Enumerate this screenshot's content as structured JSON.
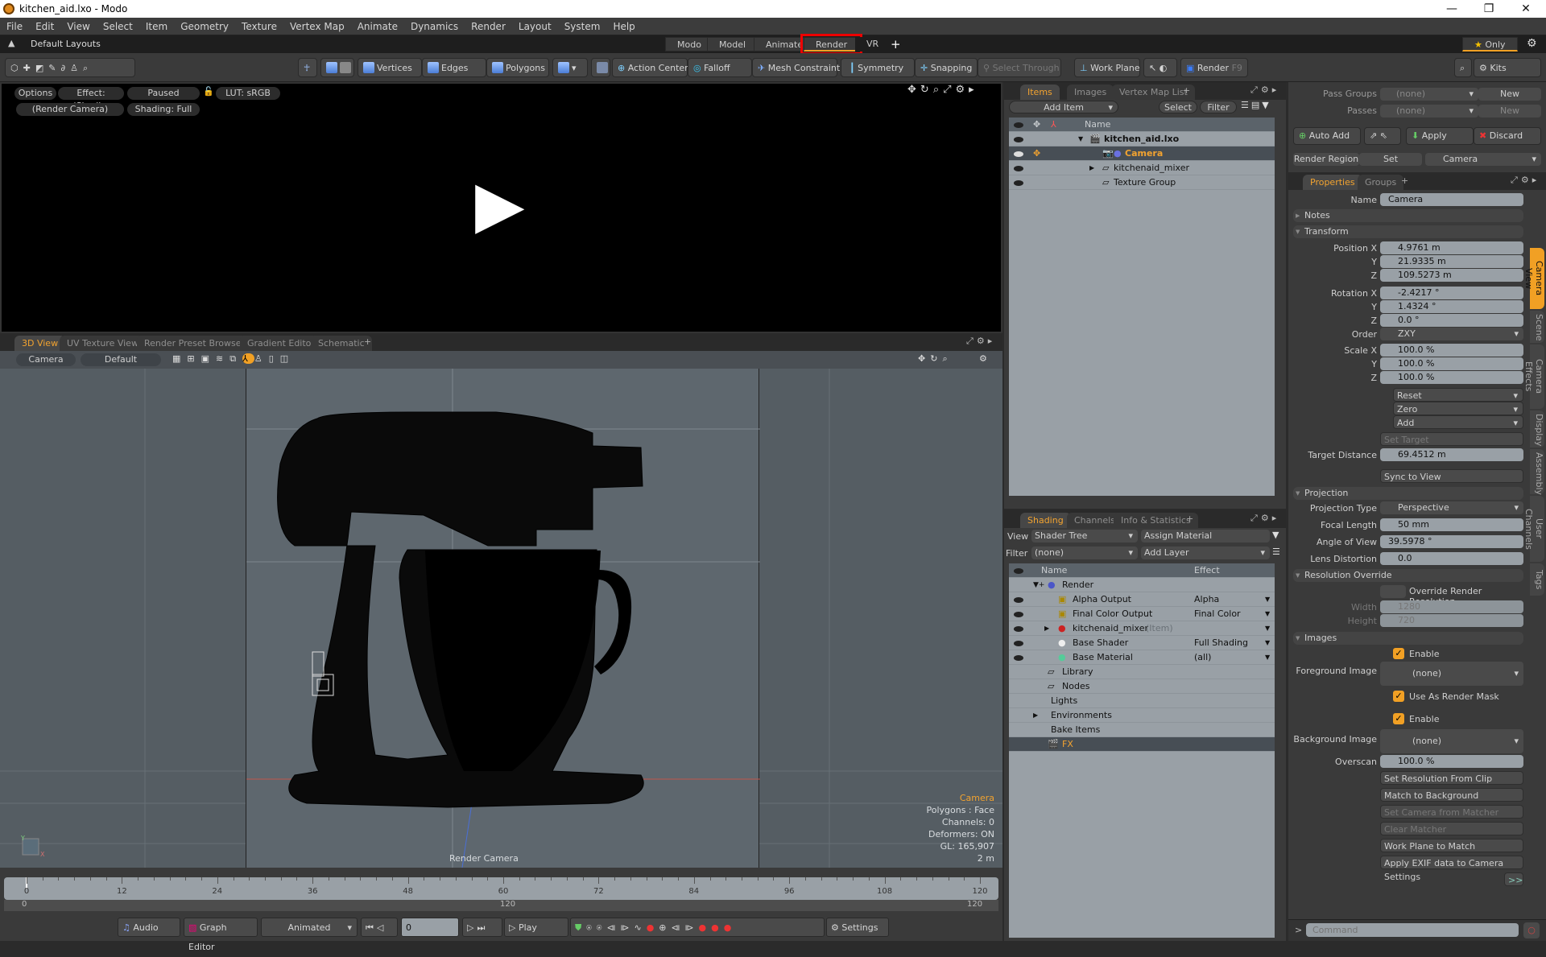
{
  "window": {
    "title": "kitchen_aid.lxo - Modo",
    "minimize": "—",
    "restore": "❐",
    "close": "✕"
  },
  "menu": [
    "File",
    "Edit",
    "View",
    "Select",
    "Item",
    "Geometry",
    "Texture",
    "Vertex Map",
    "Animate",
    "Dynamics",
    "Render",
    "Layout",
    "System",
    "Help"
  ],
  "layoutbar": {
    "layouts_label": "Default Layouts",
    "tabs": [
      "Modo",
      "Model",
      "Animate",
      "Render",
      "VR"
    ],
    "active_tab": "Render",
    "add": "+",
    "only_label": "Only"
  },
  "toolbar": {
    "vertices": "Vertices",
    "edges": "Edges",
    "polygons": "Polygons",
    "action_center": "Action Center",
    "falloff": "Falloff",
    "mesh_constraint": "Mesh Constraint",
    "symmetry": "Symmetry",
    "snapping": "Snapping",
    "select_through": "Select Through",
    "work_plane": "Work Plane",
    "render": "Render",
    "render_key": "F9",
    "kits": "Kits"
  },
  "renderview": {
    "options": "Options",
    "effect": "Effect: (Shadi...",
    "paused": "Paused",
    "lut": "LUT: sRGB",
    "camera": "(Render Camera)",
    "shading": "Shading: Full",
    "play": "▶"
  },
  "view3d": {
    "tabs": [
      "3D View",
      "UV Texture View",
      "Render Preset Browser",
      "Gradient Editor",
      "Schematic"
    ],
    "active_tab": "3D View",
    "camera_btn": "Camera",
    "default_btn": "Default",
    "info": {
      "item": "Camera",
      "polygons": "Polygons : Face",
      "channels": "Channels: 0",
      "deformers": "Deformers: ON",
      "gl": "GL: 165,907",
      "scale": "2 m"
    },
    "render_camera_label": "Render Camera"
  },
  "timeline": {
    "ticks": [
      "0",
      "12",
      "24",
      "36",
      "48",
      "60",
      "72",
      "84",
      "96",
      "108",
      "120"
    ],
    "range_start": "0",
    "range_mid": "120",
    "range_end": "120"
  },
  "transport": {
    "audio": "Audio",
    "graph_editor": "Graph Editor",
    "animated": "Animated",
    "frame": "0",
    "play": "Play",
    "settings": "Settings"
  },
  "items_panel": {
    "tabs": [
      "Items",
      "Images",
      "Vertex Map List"
    ],
    "active_tab": "Items",
    "add_item": "Add Item",
    "select": "Select",
    "filter": "Filter",
    "col_name": "Name",
    "rows": [
      {
        "name": "kitchen_aid.lxo",
        "level": 0
      },
      {
        "name": "Camera",
        "level": 1,
        "selected": true
      },
      {
        "name": "kitchenaid_mixer",
        "level": 1
      },
      {
        "name": "Texture Group",
        "level": 1
      }
    ]
  },
  "shading_panel": {
    "tabs": [
      "Shading",
      "Channels",
      "Info & Statistics"
    ],
    "active_tab": "Shading",
    "view_label": "View",
    "view_value": "Shader Tree",
    "assign_material": "Assign Material",
    "filter_label": "Filter",
    "filter_value": "(none)",
    "add_layer": "Add Layer",
    "col_name": "Name",
    "col_effect": "Effect",
    "rows": [
      {
        "name": "Render",
        "effect": "",
        "level": 0
      },
      {
        "name": "Alpha Output",
        "effect": "Alpha",
        "level": 1
      },
      {
        "name": "Final Color Output",
        "effect": "Final Color",
        "level": 1
      },
      {
        "name": "kitchenaid_mixer",
        "suffix": "(Item)",
        "effect": "",
        "level": 1
      },
      {
        "name": "Base Shader",
        "effect": "Full Shading",
        "level": 1
      },
      {
        "name": "Base Material",
        "effect": "(all)",
        "level": 1
      },
      {
        "name": "Library",
        "effect": "",
        "level": 0
      },
      {
        "name": "Nodes",
        "effect": "",
        "level": 0
      },
      {
        "name": "Lights",
        "effect": "",
        "level": 0
      },
      {
        "name": "Environments",
        "effect": "",
        "level": 0
      },
      {
        "name": "Bake Items",
        "effect": "",
        "level": 0
      },
      {
        "name": "FX",
        "effect": "",
        "level": 0,
        "selected": true
      }
    ]
  },
  "passes": {
    "pass_groups_label": "Pass Groups",
    "pass_groups_value": "(none)",
    "new": "New",
    "passes_label": "Passes",
    "passes_value": "(none)",
    "auto_add": "Auto Add",
    "apply": "Apply",
    "discard": "Discard",
    "render_region": "Render Region",
    "set": "Set",
    "camera": "Camera"
  },
  "properties": {
    "tabs": [
      "Properties",
      "Groups"
    ],
    "active_tab": "Properties",
    "name_label": "Name",
    "name_value": "Camera",
    "notes": "Notes",
    "transform": "Transform",
    "position": {
      "label": "Position X",
      "x": "4.9761 m",
      "y": "21.9335 m",
      "z": "109.5273 m"
    },
    "rotation": {
      "label": "Rotation X",
      "x": "-2.4217 °",
      "y": "1.4324 °",
      "z": "0.0 °"
    },
    "order_label": "Order",
    "order_value": "ZXY",
    "scale": {
      "label": "Scale X",
      "x": "100.0 %",
      "y": "100.0 %",
      "z": "100.0 %"
    },
    "axis_y": "Y",
    "axis_z": "Z",
    "reset": "Reset",
    "zero": "Zero",
    "add": "Add",
    "set_target": "Set Target",
    "target_distance_label": "Target Distance",
    "target_distance": "69.4512 m",
    "sync_to_view": "Sync to View",
    "projection": "Projection",
    "projection_type_label": "Projection Type",
    "projection_type": "Perspective",
    "focal_length_label": "Focal Length",
    "focal_length": "50 mm",
    "angle_of_view_label": "Angle of View",
    "angle_of_view": "39.5978 °",
    "lens_distortion_label": "Lens Distortion",
    "lens_distortion": "0.0",
    "resolution_override": "Resolution Override",
    "override_render_resolution": "Override Render Resolution",
    "width_label": "Width",
    "width": "1280",
    "height_label": "Height",
    "height": "720",
    "images": "Images",
    "enable": "Enable",
    "foreground_image_label": "Foreground Image",
    "foreground_image": "(none)",
    "use_as_render_mask": "Use As Render Mask",
    "background_image_label": "Background Image",
    "background_image": "(none)",
    "overscan_label": "Overscan",
    "overscan": "100.0 %",
    "buttons": [
      "Set Resolution From Clip",
      "Match to Background",
      "Set Camera from Matcher",
      "Clear Matcher",
      "Work Plane to Match",
      "Apply EXIF data to Camera Settings"
    ],
    "more": ">>",
    "side_tabs": [
      "Camera View",
      "Scene",
      "Camera Effects",
      "Display",
      "Assembly",
      "User Channels",
      "Tags"
    ],
    "command_placeholder": "Command"
  }
}
